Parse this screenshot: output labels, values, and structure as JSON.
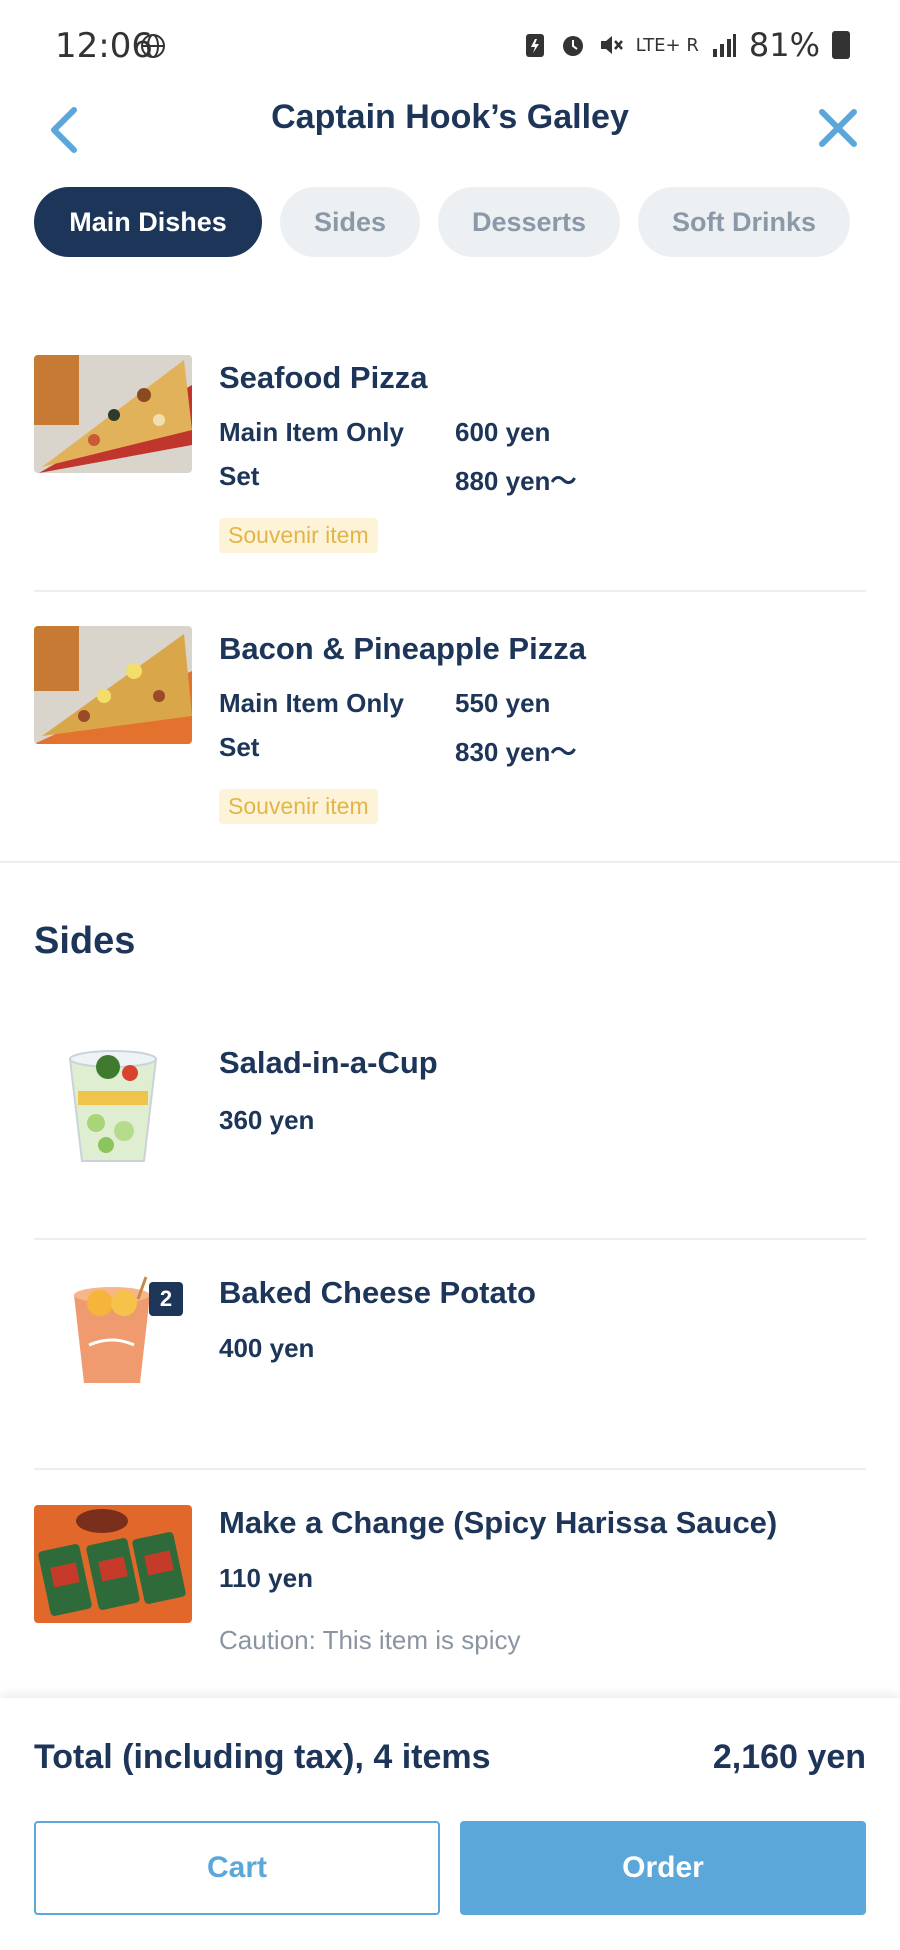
{
  "status_bar": {
    "time": "12:06",
    "network": "LTE+ R",
    "battery": "81%"
  },
  "header": {
    "title": "Captain Hook’s Galley"
  },
  "tabs": [
    {
      "label": "Main Dishes",
      "active": true
    },
    {
      "label": "Sides",
      "active": false
    },
    {
      "label": "Desserts",
      "active": false
    },
    {
      "label": "Soft Drinks",
      "active": false
    }
  ],
  "main_dishes": [
    {
      "name": "Seafood Pizza",
      "prices": [
        {
          "label": "Main Item Only",
          "value": "600 yen"
        },
        {
          "label": "Set",
          "value": "880 yen〜"
        }
      ],
      "badge": "Souvenir item"
    },
    {
      "name": "Bacon & Pineapple Pizza",
      "prices": [
        {
          "label": "Main Item Only",
          "value": "550 yen"
        },
        {
          "label": "Set",
          "value": "830 yen〜"
        }
      ],
      "badge": "Souvenir item"
    }
  ],
  "sides_section": {
    "title": "Sides",
    "items": [
      {
        "name": "Salad-in-a-Cup",
        "price": "360 yen"
      },
      {
        "name": "Baked Cheese Potato",
        "price": "400 yen",
        "quantity": "2"
      },
      {
        "name": "Make a Change (Spicy Harissa Sauce)",
        "price": "110 yen",
        "caution": "Caution: This item is spicy"
      }
    ]
  },
  "footer": {
    "total_label": "Total (including tax), 4 items",
    "total_value": "2,160 yen",
    "cart_label": "Cart",
    "order_label": "Order"
  },
  "colors": {
    "navy": "#1c3558",
    "accent_blue": "#5ba7da",
    "badge_bg": "#fdf3d9",
    "badge_text": "#e3b548"
  }
}
